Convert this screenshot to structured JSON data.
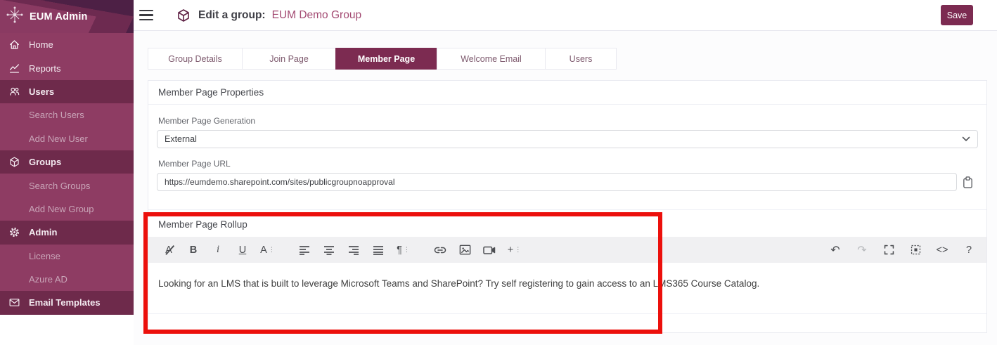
{
  "sidebar": {
    "brand": "EUM Admin",
    "items": [
      {
        "label": "Home",
        "type": "item",
        "icon": "home-icon"
      },
      {
        "label": "Reports",
        "type": "item",
        "icon": "reports-icon"
      },
      {
        "label": "Users",
        "type": "section",
        "icon": "users-icon"
      },
      {
        "label": "Search Users",
        "type": "subitem"
      },
      {
        "label": "Add New User",
        "type": "subitem"
      },
      {
        "label": "Groups",
        "type": "section",
        "icon": "cube-icon"
      },
      {
        "label": "Search Groups",
        "type": "subitem"
      },
      {
        "label": "Add New Group",
        "type": "subitem"
      },
      {
        "label": "Admin",
        "type": "section",
        "icon": "gear-icon"
      },
      {
        "label": "License",
        "type": "subitem"
      },
      {
        "label": "Azure AD",
        "type": "subitem"
      },
      {
        "label": "Email Templates",
        "type": "section",
        "icon": "envelope-icon"
      }
    ]
  },
  "header": {
    "title": "Edit a group:",
    "group_name": "EUM Demo Group",
    "save_label": "Save"
  },
  "tabs": [
    {
      "label": "Group Details",
      "active": false
    },
    {
      "label": "Join Page",
      "active": false
    },
    {
      "label": "Member Page",
      "active": true
    },
    {
      "label": "Welcome Email",
      "active": false
    },
    {
      "label": "Users",
      "active": false
    }
  ],
  "form": {
    "section_title": "Member Page Properties",
    "generation_label": "Member Page Generation",
    "generation_value": "External",
    "url_label": "Member Page URL",
    "url_value": "https://eumdemo.sharepoint.com/sites/publicgroupnoapproval",
    "rollup_label": "Member Page Rollup",
    "rollup_text": "Looking for an LMS that is built to leverage Microsoft Teams and SharePoint? Try self registering to gain access to an LMS365 Course Catalog."
  },
  "editor_toolbar": {
    "glyphs": {
      "clear_format": "A",
      "bold": "B",
      "italic": "i",
      "underline": "U",
      "font_size": "A",
      "paragraph": "¶",
      "insert_more": "+",
      "code_view": "<>",
      "help": "?",
      "undo": "↶",
      "redo": "↷",
      "dropdown_dots": "⋮"
    },
    "left_icons": [
      "clear-formatting",
      "bold",
      "italic",
      "underline",
      "font-size",
      "align-left",
      "align-center",
      "align-right",
      "align-justify",
      "paragraph-format",
      "insert-link",
      "insert-image",
      "insert-video",
      "insert-more"
    ],
    "right_icons": [
      "undo",
      "redo",
      "fullscreen",
      "select-all",
      "code-view",
      "help"
    ]
  },
  "colors": {
    "accent": "#7c2b51",
    "sidebar_bg": "#8e3c63",
    "sidebar_section_bg": "#6e2a4b",
    "group_name_text": "#a34a72",
    "annotation_red": "#ec100c",
    "toolbar_bg": "#f0f0f2"
  }
}
